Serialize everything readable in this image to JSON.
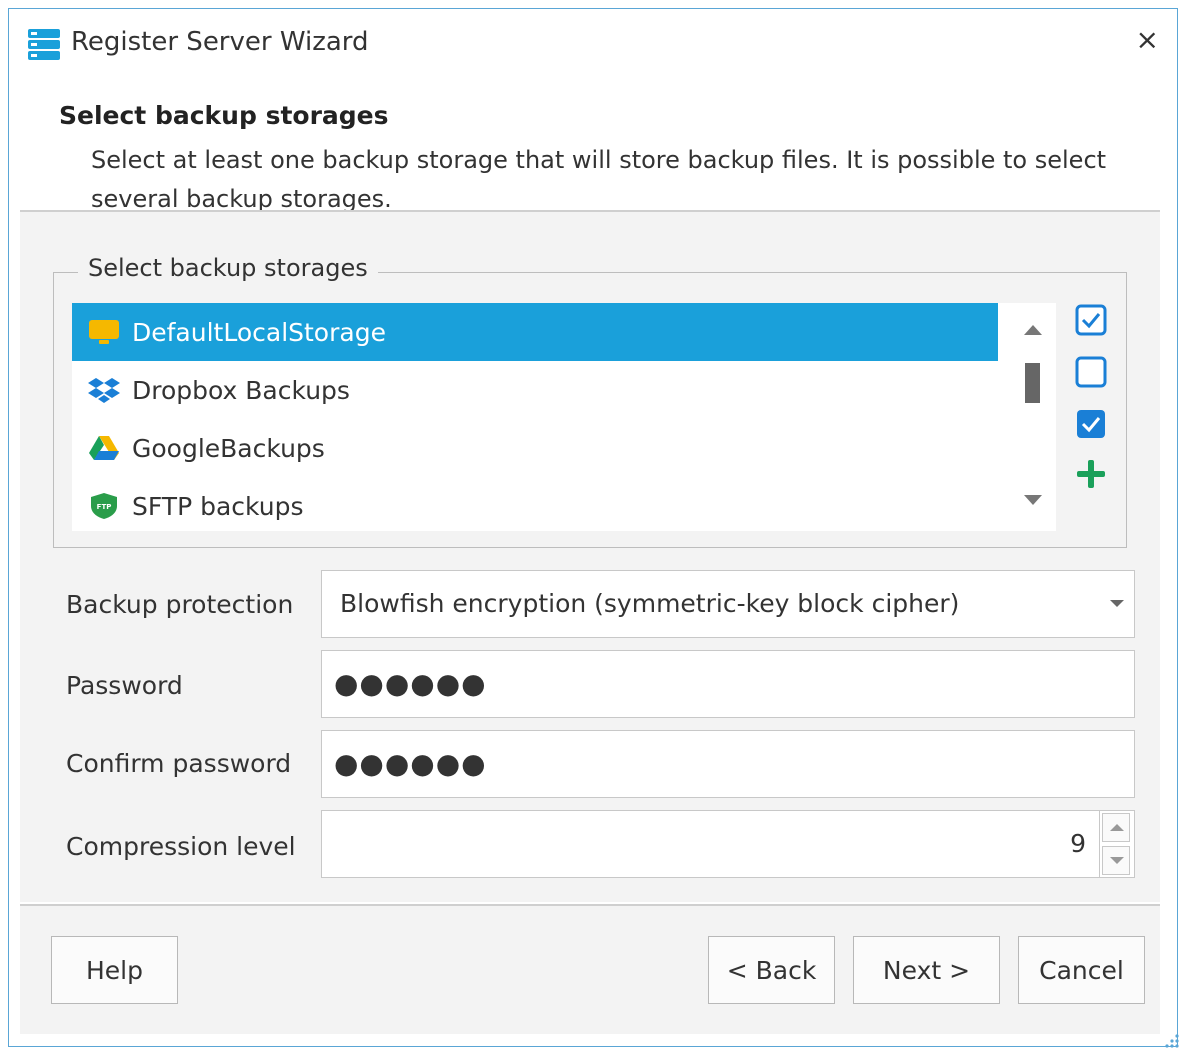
{
  "window": {
    "title": "Register Server Wizard",
    "close_glyph": "×",
    "icon": "server-stack-icon"
  },
  "header": {
    "step_title": "Select backup storages",
    "step_description": "Select at least one backup storage that will store backup files. It is possible to select several backup storages."
  },
  "storages": {
    "group_label": "Select backup storages",
    "items": [
      {
        "label": "DefaultLocalStorage",
        "icon": "local-storage-icon",
        "selected": true
      },
      {
        "label": "Dropbox Backups",
        "icon": "dropbox-icon",
        "selected": false
      },
      {
        "label": "GoogleBackups",
        "icon": "google-drive-icon",
        "selected": false
      },
      {
        "label": "SFTP backups",
        "icon": "sftp-shield-icon",
        "selected": false
      }
    ],
    "tools": [
      "check-all-icon",
      "uncheck-all-icon",
      "checked-checkbox-icon",
      "add-storage-icon"
    ]
  },
  "form": {
    "protection_label": "Backup protection",
    "protection_value": "Blowfish encryption (symmetric-key block cipher)",
    "password_label": "Password",
    "password_value": "●●●●●●",
    "confirm_label": "Confirm password",
    "confirm_value": "●●●●●●",
    "compression_label": "Compression level",
    "compression_value": "9"
  },
  "footer": {
    "help": "Help",
    "back": "< Back",
    "next": "Next >",
    "cancel": "Cancel"
  },
  "colors": {
    "accent": "#1aa0da",
    "add": "#1aa05a",
    "checkbox": "#1a7fd6"
  }
}
